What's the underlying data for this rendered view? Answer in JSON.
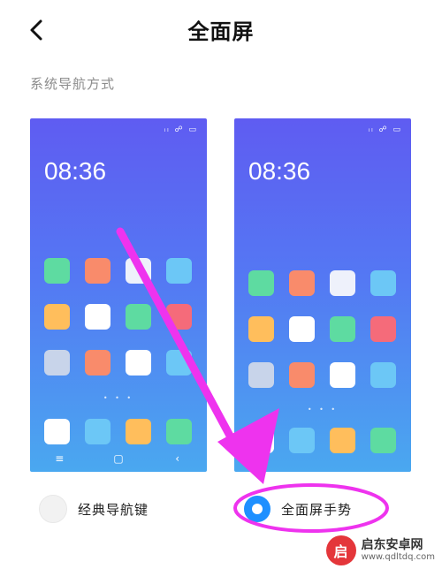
{
  "header": {
    "title": "全面屏"
  },
  "section": {
    "label": "系统导航方式"
  },
  "phones": {
    "classic": {
      "status": "ᵢₗ ☍ ▭",
      "time": "08:36",
      "dots": "• • •",
      "nav": {
        "menu": "≡",
        "home": "▢",
        "back": "‹"
      },
      "apps": [
        "#5edba1",
        "#f98b6b",
        "#eef1fb",
        "#6cc7f6",
        "#ffbe5c",
        "#ffffff",
        "#5edba1",
        "#f56b7a",
        "#c8d4ea",
        "#f98b6b",
        "#ffffff",
        "#6cc7f6"
      ],
      "dock": [
        "#ffffff",
        "#6cc7f6",
        "#ffbe5c",
        "#5edba1"
      ]
    },
    "gesture": {
      "status": "ᵢₗ ☍ ▭",
      "time": "08:36",
      "dots": "• • •",
      "apps": [
        "#5edba1",
        "#f98b6b",
        "#eef1fb",
        "#6cc7f6",
        "#ffbe5c",
        "#ffffff",
        "#5edba1",
        "#f56b7a",
        "#c8d4ea",
        "#f98b6b",
        "#ffffff",
        "#6cc7f6"
      ],
      "dock": [
        "#ffffff",
        "#6cc7f6",
        "#ffbe5c",
        "#5edba1"
      ]
    }
  },
  "options": [
    {
      "label": "经典导航键",
      "selected": false
    },
    {
      "label": "全面屏手势",
      "selected": true
    }
  ],
  "annotation": {
    "color": "#ee33ee"
  },
  "watermark": {
    "logo": "启",
    "title": "启东安卓网",
    "url": "www.qdltdq.com"
  },
  "colors": {
    "accent": "#1e90ff",
    "gradient_top": "#5f5cf2",
    "gradient_bottom": "#4aa8f0"
  }
}
